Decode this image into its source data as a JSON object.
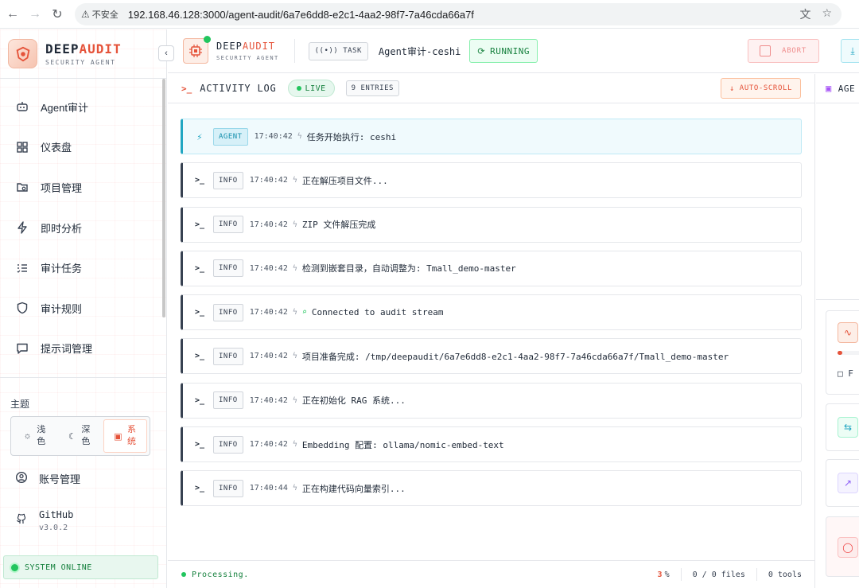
{
  "browser": {
    "security_label": "不安全",
    "url": "192.168.46.128:3000/agent-audit/6a7e6dd8-e2c1-4aa2-98f7-7a46cda66a7f"
  },
  "sidebar": {
    "brand_part1": "DEEP",
    "brand_part2": "AUDIT",
    "brand_sub": "SECURITY AGENT",
    "collapse_icon": "chevron-left-icon",
    "items": [
      {
        "label": "Agent审计",
        "icon": "robot-icon"
      },
      {
        "label": "仪表盘",
        "icon": "dashboard-icon"
      },
      {
        "label": "项目管理",
        "icon": "folder-icon"
      },
      {
        "label": "即时分析",
        "icon": "bolt-icon"
      },
      {
        "label": "审计任务",
        "icon": "list-check-icon"
      },
      {
        "label": "审计规则",
        "icon": "shield-icon"
      },
      {
        "label": "提示词管理",
        "icon": "message-icon"
      }
    ],
    "theme": {
      "label": "主题",
      "options": [
        {
          "label": "浅色",
          "icon": "sun-icon",
          "active": false
        },
        {
          "label": "深色",
          "icon": "moon-icon",
          "active": false
        },
        {
          "label": "系统",
          "icon": "monitor-icon",
          "active": true
        }
      ]
    },
    "account_label": "账号管理",
    "github_label": "GitHub",
    "version": "v3.0.2",
    "system_status": "SYSTEM ONLINE"
  },
  "topbar": {
    "brand_part1": "DEEP",
    "brand_part2": "AUDIT",
    "brand_sub": "SECURITY AGENT",
    "task_chip": "TASK",
    "task_name": "Agent审计-ceshi",
    "status": "RUNNING",
    "abort_label": "ABORT"
  },
  "log": {
    "title": "ACTIVITY LOG",
    "prompt": ">_",
    "live_label": "LIVE",
    "entries_label": "9 ENTRIES",
    "autoscroll_label": "AUTO-SCROLL",
    "entries": [
      {
        "level": "AGENT",
        "time": "17:40:42",
        "message": "任务开始执行: ceshi",
        "icon": "bolt-icon",
        "wifi": false
      },
      {
        "level": "INFO",
        "time": "17:40:42",
        "message": "正在解压项目文件...",
        "icon": "terminal-icon",
        "wifi": false
      },
      {
        "level": "INFO",
        "time": "17:40:42",
        "message": "ZIP 文件解压完成",
        "icon": "terminal-icon",
        "wifi": false
      },
      {
        "level": "INFO",
        "time": "17:40:42",
        "message": "检测到嵌套目录，自动调整为: Tmall_demo-master",
        "icon": "terminal-icon",
        "wifi": false
      },
      {
        "level": "INFO",
        "time": "17:40:42",
        "message": "Connected to audit stream",
        "icon": "terminal-icon",
        "wifi": true
      },
      {
        "level": "INFO",
        "time": "17:40:42",
        "message": "项目准备完成: /tmp/deepaudit/6a7e6dd8-e2c1-4aa2-98f7-7a46cda66a7f/Tmall_demo-master",
        "icon": "terminal-icon",
        "wifi": false
      },
      {
        "level": "INFO",
        "time": "17:40:42",
        "message": "正在初始化 RAG 系统...",
        "icon": "terminal-icon",
        "wifi": false
      },
      {
        "level": "INFO",
        "time": "17:40:42",
        "message": "Embedding 配置: ollama/nomic-embed-text",
        "icon": "terminal-icon",
        "wifi": false
      },
      {
        "level": "INFO",
        "time": "17:40:44",
        "message": "正在构建代码向量索引...",
        "icon": "terminal-icon",
        "wifi": false
      }
    ],
    "footer": {
      "status": "Processing.",
      "progress_value": "3",
      "progress_unit": "%",
      "files": "0 / 0 files",
      "tools": "0 tools"
    }
  },
  "right_panel": {
    "title": "AGE",
    "file_label": "F"
  },
  "colors": {
    "accent": "#e5533a",
    "success": "#22c55e",
    "agent": "#22a6c2"
  }
}
